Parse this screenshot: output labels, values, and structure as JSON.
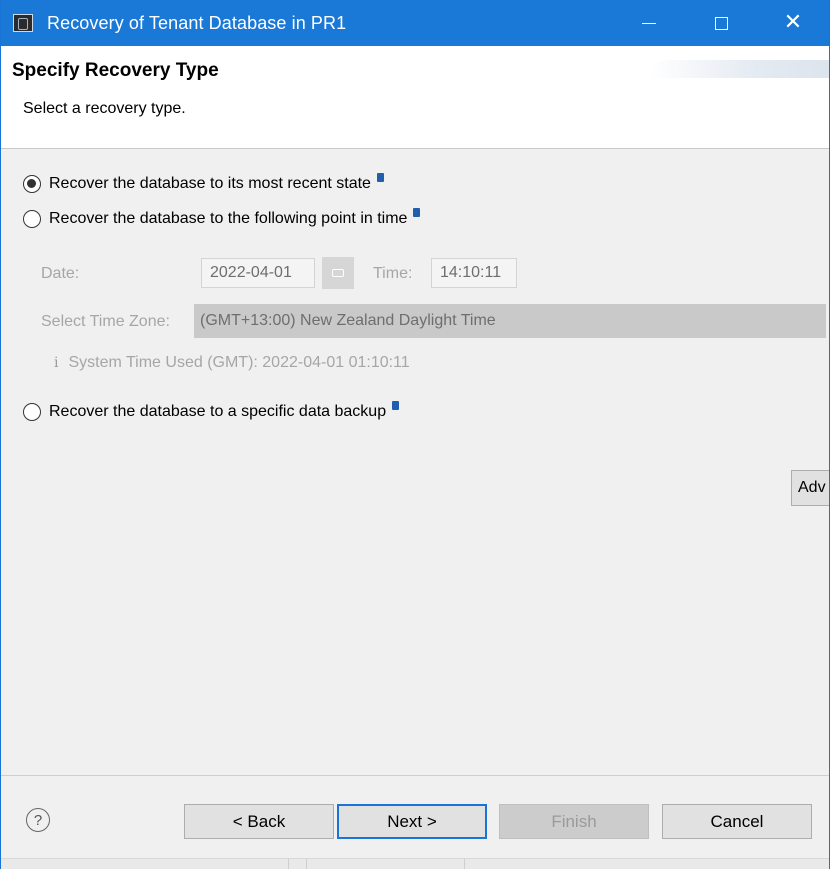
{
  "window": {
    "title": "Recovery of Tenant Database in PR1",
    "title_bar_color": "#1a78d6",
    "controls": {
      "minimize_icon": "minimize-icon",
      "maximize_icon": "maximize-icon",
      "close_icon": "close-icon"
    }
  },
  "header": {
    "title": "Specify Recovery Type",
    "subtitle": "Select a recovery type."
  },
  "options": {
    "recent_state": {
      "label": "Recover the database to its most recent state",
      "selected": true
    },
    "point_in_time": {
      "label": "Recover the database to the following point in time",
      "selected": false
    },
    "data_backup": {
      "label": "Recover the database to a specific data backup",
      "selected": false
    }
  },
  "point_in_time": {
    "date_label": "Date:",
    "date_value": "2022-04-01",
    "time_label": "Time:",
    "time_value": "14:10:11",
    "tz_label": "Select Time Zone:",
    "tz_value": "(GMT+13:00) New Zealand Daylight Time",
    "system_time": "System Time Used (GMT): 2022-04-01 01:10:11"
  },
  "advanced_button": {
    "label": "Adv"
  },
  "footer": {
    "help": "?",
    "back": "< Back",
    "next": "Next >",
    "finish": "Finish",
    "cancel": "Cancel"
  }
}
